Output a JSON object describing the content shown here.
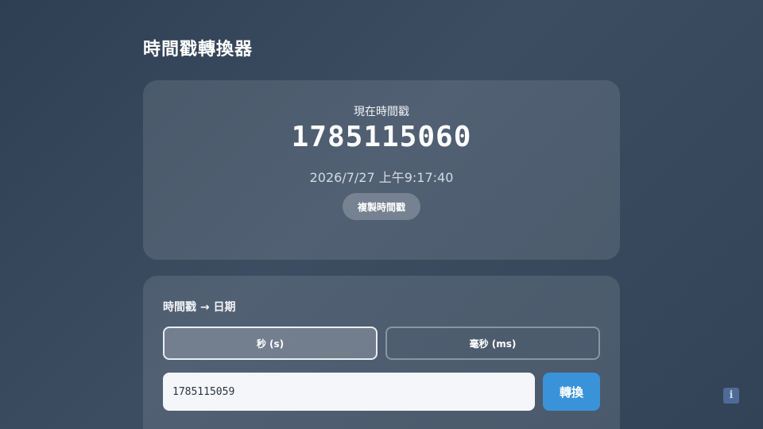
{
  "header": {
    "title": "時間戳轉換器"
  },
  "current": {
    "label": "現在時間戳",
    "timestamp": "1785115060",
    "datetime": "2026/7/27 上午9:17:40",
    "copy_label": "複製時間戳"
  },
  "converter": {
    "title": "時間戳 → 日期",
    "units": [
      {
        "label": "秒 (s)",
        "selected": true
      },
      {
        "label": "毫秒 (ms)",
        "selected": false
      }
    ],
    "input_value": "1785115059",
    "convert_label": "轉換"
  },
  "info": {
    "icon": "info-icon",
    "glyph": "i"
  },
  "colors": {
    "accent": "#3a93d9",
    "background": "#3c4d62"
  }
}
